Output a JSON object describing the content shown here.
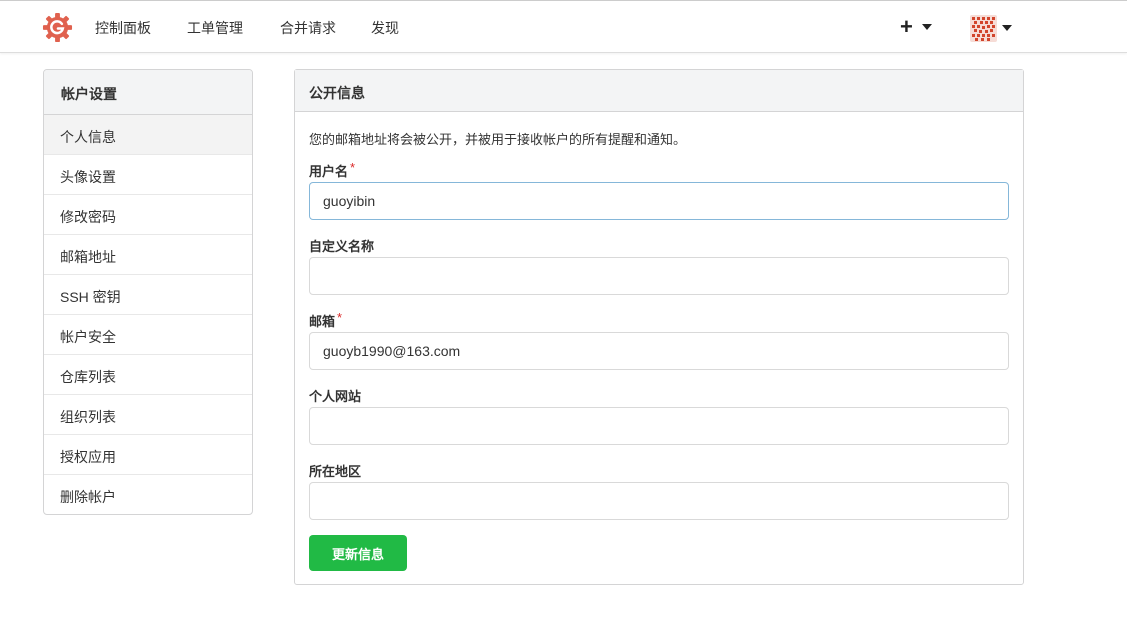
{
  "nav": {
    "items": [
      "控制面板",
      "工单管理",
      "合并请求",
      "发现"
    ],
    "plus_icon": "+",
    "icons": {
      "logo": "gitea-logo-icon",
      "create": "plus-icon",
      "avatar": "user-avatar"
    }
  },
  "sidebar": {
    "title": "帐户设置",
    "items": [
      {
        "label": "个人信息",
        "active": true
      },
      {
        "label": "头像设置"
      },
      {
        "label": "修改密码"
      },
      {
        "label": "邮箱地址"
      },
      {
        "label": "SSH 密钥"
      },
      {
        "label": "帐户安全"
      },
      {
        "label": "仓库列表"
      },
      {
        "label": "组织列表"
      },
      {
        "label": "授权应用"
      },
      {
        "label": "删除帐户"
      }
    ]
  },
  "profile": {
    "title": "公开信息",
    "description": "您的邮箱地址将会被公开，并被用于接收帐户的所有提醒和通知。",
    "required_mark": "*",
    "fields": {
      "username": {
        "label": "用户名",
        "value": "guoyibin",
        "required": true
      },
      "full_name": {
        "label": "自定义名称",
        "value": ""
      },
      "email": {
        "label": "邮箱",
        "value": "guoyb1990@163.com",
        "required": true
      },
      "website": {
        "label": "个人网站",
        "value": ""
      },
      "location": {
        "label": "所在地区",
        "value": ""
      }
    },
    "submit_label": "更新信息"
  },
  "colors": {
    "accent": "#e0614e",
    "submit": "#21ba45",
    "required": "#db2828",
    "focus_border": "#85b7d9"
  }
}
